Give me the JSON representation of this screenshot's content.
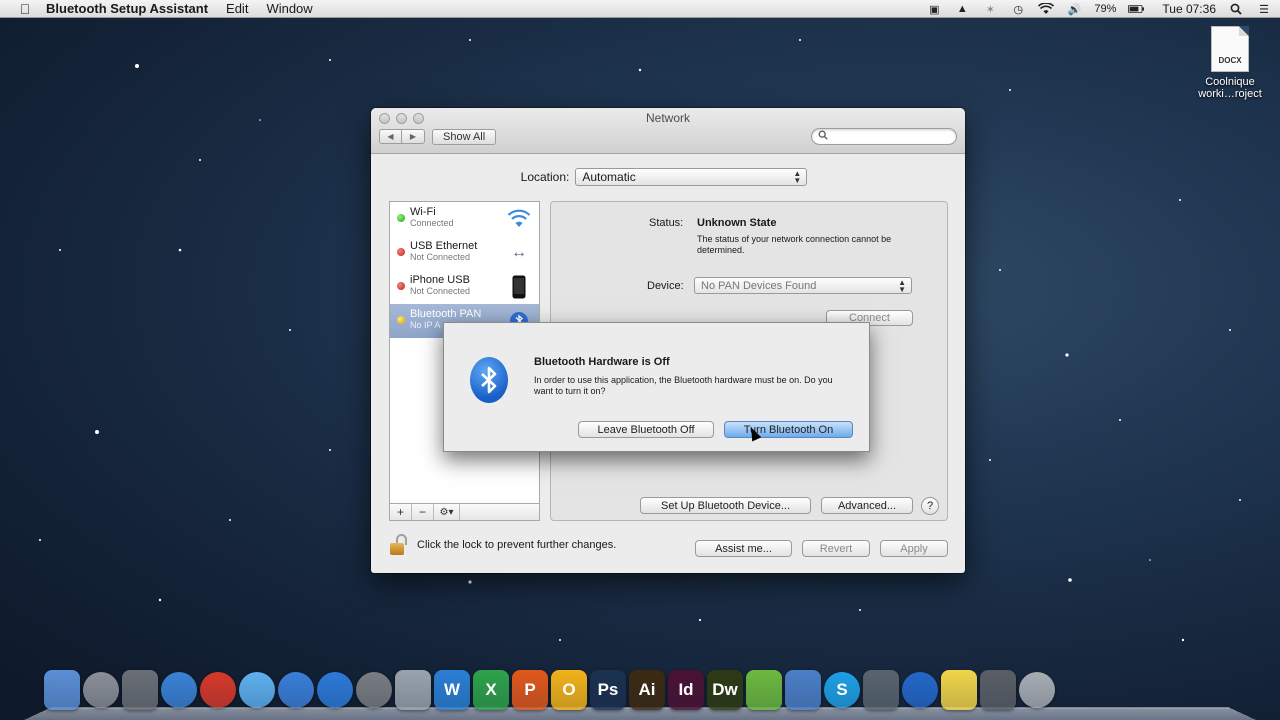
{
  "menubar": {
    "app_name": "Bluetooth Setup Assistant",
    "menus": [
      "Edit",
      "Window"
    ],
    "battery": "79%",
    "clock": "Tue 07:36"
  },
  "desktop": {
    "file_ext": "DOCX",
    "file_label_line1": "Coolnique",
    "file_label_line2": "worki…roject"
  },
  "window": {
    "title": "Network",
    "show_all": "Show All",
    "search_placeholder": "",
    "location_label": "Location:",
    "location_value": "Automatic"
  },
  "services": [
    {
      "name": "Wi-Fi",
      "status": "Connected",
      "dot": "green",
      "icon": "wifi-icon"
    },
    {
      "name": "USB Ethernet",
      "status": "Not Connected",
      "dot": "red",
      "icon": "ethernet-arrows-icon"
    },
    {
      "name": "iPhone USB",
      "status": "Not Connected",
      "dot": "red",
      "icon": "iphone-icon"
    },
    {
      "name": "Bluetooth PAN",
      "status": "No IP A",
      "dot": "yellow",
      "icon": "bluetooth-icon"
    }
  ],
  "detail": {
    "status_label": "Status:",
    "status_value": "Unknown State",
    "status_desc": "The status of your network connection cannot be determined.",
    "device_label": "Device:",
    "device_value": "No PAN Devices Found",
    "connect": "Connect",
    "setup_bt": "Set Up Bluetooth Device...",
    "advanced": "Advanced...",
    "help": "?"
  },
  "footer": {
    "lock_text": "Click the lock to prevent further changes.",
    "assist": "Assist me...",
    "revert": "Revert",
    "apply": "Apply"
  },
  "alert": {
    "title": "Bluetooth Hardware is Off",
    "message": "In order to use this application, the Bluetooth hardware must be on.  Do you want to turn it on?",
    "leave_button": "Leave Bluetooth Off",
    "turn_on_button": "Turn Bluetooth On"
  },
  "dock": [
    {
      "name": "finder",
      "glyph": "",
      "bg": "#5b8fd6"
    },
    {
      "name": "launchpad",
      "glyph": "",
      "bg": "#8a8f98"
    },
    {
      "name": "photo-app",
      "glyph": "",
      "bg": "#6a6f76"
    },
    {
      "name": "safari",
      "glyph": "",
      "bg": "#3b82d6"
    },
    {
      "name": "chrome",
      "glyph": "",
      "bg": "#d7392b"
    },
    {
      "name": "messages",
      "glyph": "",
      "bg": "#5fb0f0"
    },
    {
      "name": "itunes",
      "glyph": "",
      "bg": "#3a7fd8"
    },
    {
      "name": "app-store",
      "glyph": "",
      "bg": "#2d7ad9"
    },
    {
      "name": "system-preferences",
      "glyph": "",
      "bg": "#7a7d82"
    },
    {
      "name": "utility",
      "glyph": "",
      "bg": "#9aa3ad"
    },
    {
      "name": "word",
      "glyph": "W",
      "bg": "#2b7fd4"
    },
    {
      "name": "excel",
      "glyph": "X",
      "bg": "#2ea24a"
    },
    {
      "name": "powerpoint",
      "glyph": "P",
      "bg": "#e0581c"
    },
    {
      "name": "outlook",
      "glyph": "O",
      "bg": "#f2b31a"
    },
    {
      "name": "photoshop",
      "glyph": "Ps",
      "bg": "#1b3150"
    },
    {
      "name": "illustrator",
      "glyph": "Ai",
      "bg": "#3d2a12"
    },
    {
      "name": "indesign",
      "glyph": "Id",
      "bg": "#4a1235"
    },
    {
      "name": "dreamweaver",
      "glyph": "Dw",
      "bg": "#2e3a14"
    },
    {
      "name": "evernote",
      "glyph": "",
      "bg": "#6cb93f"
    },
    {
      "name": "xcode",
      "glyph": "",
      "bg": "#4b7fc8"
    },
    {
      "name": "skype",
      "glyph": "S",
      "bg": "#1ea0e6"
    },
    {
      "name": "imovie",
      "glyph": "",
      "bg": "#58636e"
    },
    {
      "name": "bluetooth-assistant",
      "glyph": "",
      "bg": "#2467c8"
    },
    {
      "name": "notes",
      "glyph": "",
      "bg": "#f1d54a"
    },
    {
      "name": "downloads-folder",
      "glyph": "",
      "bg": "#5a5f66"
    },
    {
      "name": "trash",
      "glyph": "",
      "bg": "#a8adb4"
    }
  ]
}
